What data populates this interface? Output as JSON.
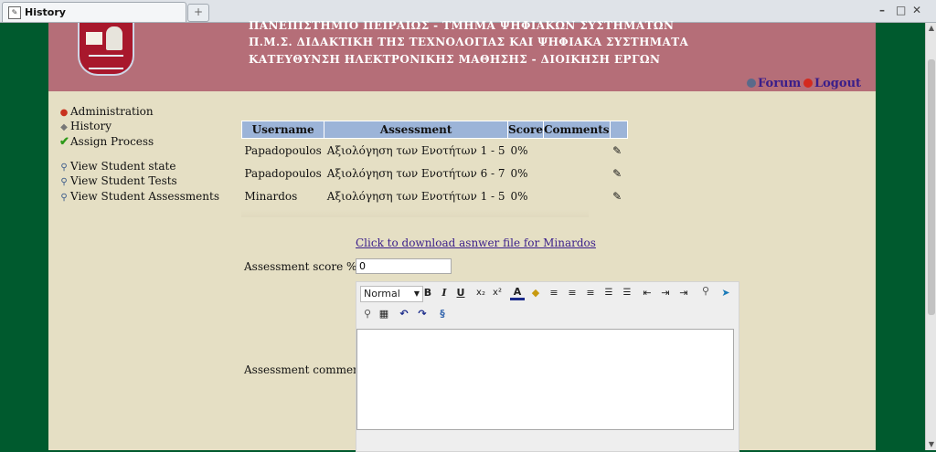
{
  "browser": {
    "tab_title": "History",
    "new_tab_symbol": "+",
    "window_controls": [
      "–",
      "□",
      "✕"
    ]
  },
  "banner": {
    "lines": [
      "ΠΑΝΕΠΙΣΤΗΜΙΟ ΠΕΙΡΑΙΩΣ - ΤΜΗΜΑ ΨΗΦΙΑΚΩΝ ΣΥΣΤΗΜΑΤΩΝ",
      "Π.Μ.Σ. ΔΙΔΑΚΤΙΚΗ ΤΗΣ ΤΕΧΝΟΛΟΓΙΑΣ ΚΑΙ ΨΗΦΙΑΚΑ ΣΥΣΤΗΜΑΤΑ",
      "ΚΑΤΕΥΘΥΝΣΗ ΗΛΕΚΤΡΟΝΙΚΗΣ ΜΑΘΗΣΗΣ - ΔΙΟΙΚΗΣΗ ΕΡΓΩΝ"
    ],
    "forum_label": "Forum",
    "logout_label": "Logout"
  },
  "sidebar": {
    "items": [
      {
        "label": "Administration",
        "icon": "red-ball-icon"
      },
      {
        "label": "History",
        "icon": "history-icon"
      },
      {
        "label": "Assign Process",
        "icon": "checkmark-icon"
      },
      {
        "label": "View Student state",
        "icon": "magnifier-icon"
      },
      {
        "label": "View Student Tests",
        "icon": "magnifier-icon"
      },
      {
        "label": "View Student Assessments",
        "icon": "magnifier-icon"
      }
    ]
  },
  "table": {
    "headers": [
      "Username",
      "Assessment",
      "Score",
      "Comments",
      ""
    ],
    "rows": [
      {
        "username": "Papadopoulos",
        "assessment": "Αξιολόγηση των Ενοτήτων 1 - 5",
        "score": "0%"
      },
      {
        "username": "Papadopoulos",
        "assessment": "Αξιολόγηση των Ενοτήτων 6 - 7",
        "score": "0%"
      },
      {
        "username": "Minardos",
        "assessment": "Αξιολόγηση των Ενοτήτων 1 - 5",
        "score": "0%"
      }
    ]
  },
  "form": {
    "download_link": "Click to download asnwer file for Minardos",
    "score_label": "Assessment score %",
    "score_value": "0",
    "comments_label": "Assessment comments",
    "editor": {
      "format_select": "Normal",
      "bold": "B",
      "italic": "I",
      "underline": "U",
      "subscript": "x₂",
      "superscript": "x²"
    }
  },
  "colors": {
    "banner": "#b56e78",
    "page_bg": "#e5dfc4",
    "frame_green": "#005a2e",
    "table_header": "#9cb4d8",
    "link": "#3a1e8a"
  }
}
